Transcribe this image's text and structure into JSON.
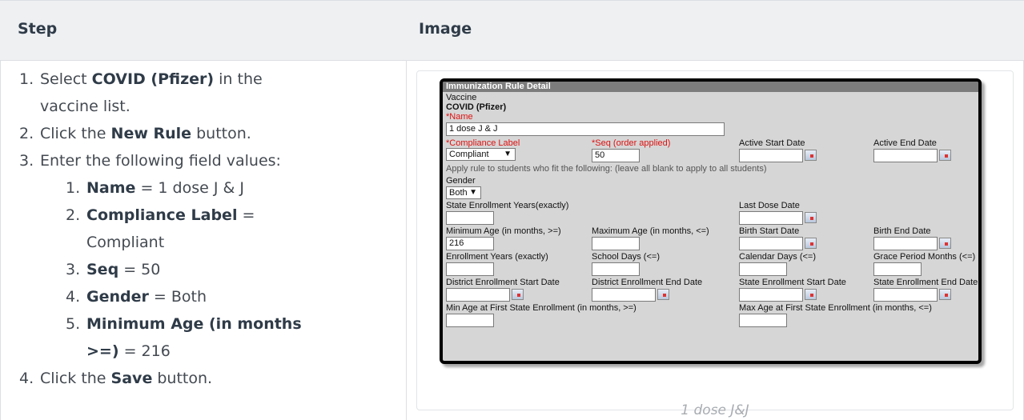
{
  "table": {
    "header_step": "Step",
    "header_image": "Image"
  },
  "steps": [
    {
      "num": "1.",
      "pre": "Select ",
      "bold": "COVID (Pfizer)",
      "post": " in the"
    },
    {
      "num": "",
      "pre": "vaccine list.",
      "bold": "",
      "post": ""
    },
    {
      "num": "2.",
      "pre": "Click the ",
      "bold": "New Rule",
      "post": " button."
    },
    {
      "num": "3.",
      "pre": "Enter the following field values:",
      "bold": "",
      "post": ""
    }
  ],
  "substeps": [
    {
      "num": "1.",
      "bold": "Name",
      "post": " = 1 dose J & J"
    },
    {
      "num": "2.",
      "bold": "Compliance Label",
      "post": " ="
    },
    {
      "num": "",
      "bold": "",
      "post": "Compliant"
    },
    {
      "num": "3.",
      "bold": "Seq",
      "post": " = 50"
    },
    {
      "num": "4.",
      "bold": "Gender",
      "post": " = Both"
    },
    {
      "num": "5.",
      "bold": "Minimum Age (in months",
      "post": ""
    },
    {
      "num": "",
      "bold": ">=)",
      "post": " = 216"
    }
  ],
  "final_step": {
    "num": "4.",
    "pre": "Click the ",
    "bold": "Save",
    "post": " button."
  },
  "caption": "1 dose J&J",
  "screenshot": {
    "title": "Immunization Rule Detail",
    "vaccine_label": "Vaccine",
    "vaccine_value": "COVID (Pfizer)",
    "name_label": "*Name",
    "name_value": "1 dose J & J",
    "compliance_label": "*Compliance Label",
    "compliance_value": "Compliant",
    "seq_label": "*Seq (order applied)",
    "seq_value": "50",
    "active_start_label": "Active Start Date",
    "active_end_label": "Active End Date",
    "apply_note": "Apply rule to students who fit the following: (leave all blank to apply to all students)",
    "gender_label": "Gender",
    "gender_value": "Both",
    "state_enroll_years_label": "State Enrollment Years(exactly)",
    "last_dose_label": "Last Dose Date",
    "min_age_label": "Minimum Age (in months, >=)",
    "min_age_value": "216",
    "max_age_label": "Maximum Age (in months, <=)",
    "birth_start_label": "Birth Start Date",
    "birth_end_label": "Birth End Date",
    "enroll_years_label": "Enrollment Years (exactly)",
    "school_days_label": "School Days (<=)",
    "calendar_days_label": "Calendar Days (<=)",
    "grace_period_label": "Grace Period Months (<=)",
    "district_start_label": "District Enrollment Start Date",
    "district_end_label": "District Enrollment End Date",
    "state_start_label": "State Enrollment Start Date",
    "state_end_label": "State Enrollment End Date",
    "min_age_first_label": "Min Age at First State Enrollment (in months, >=)",
    "max_age_first_label": "Max Age at First State Enrollment (in months, <=)"
  }
}
